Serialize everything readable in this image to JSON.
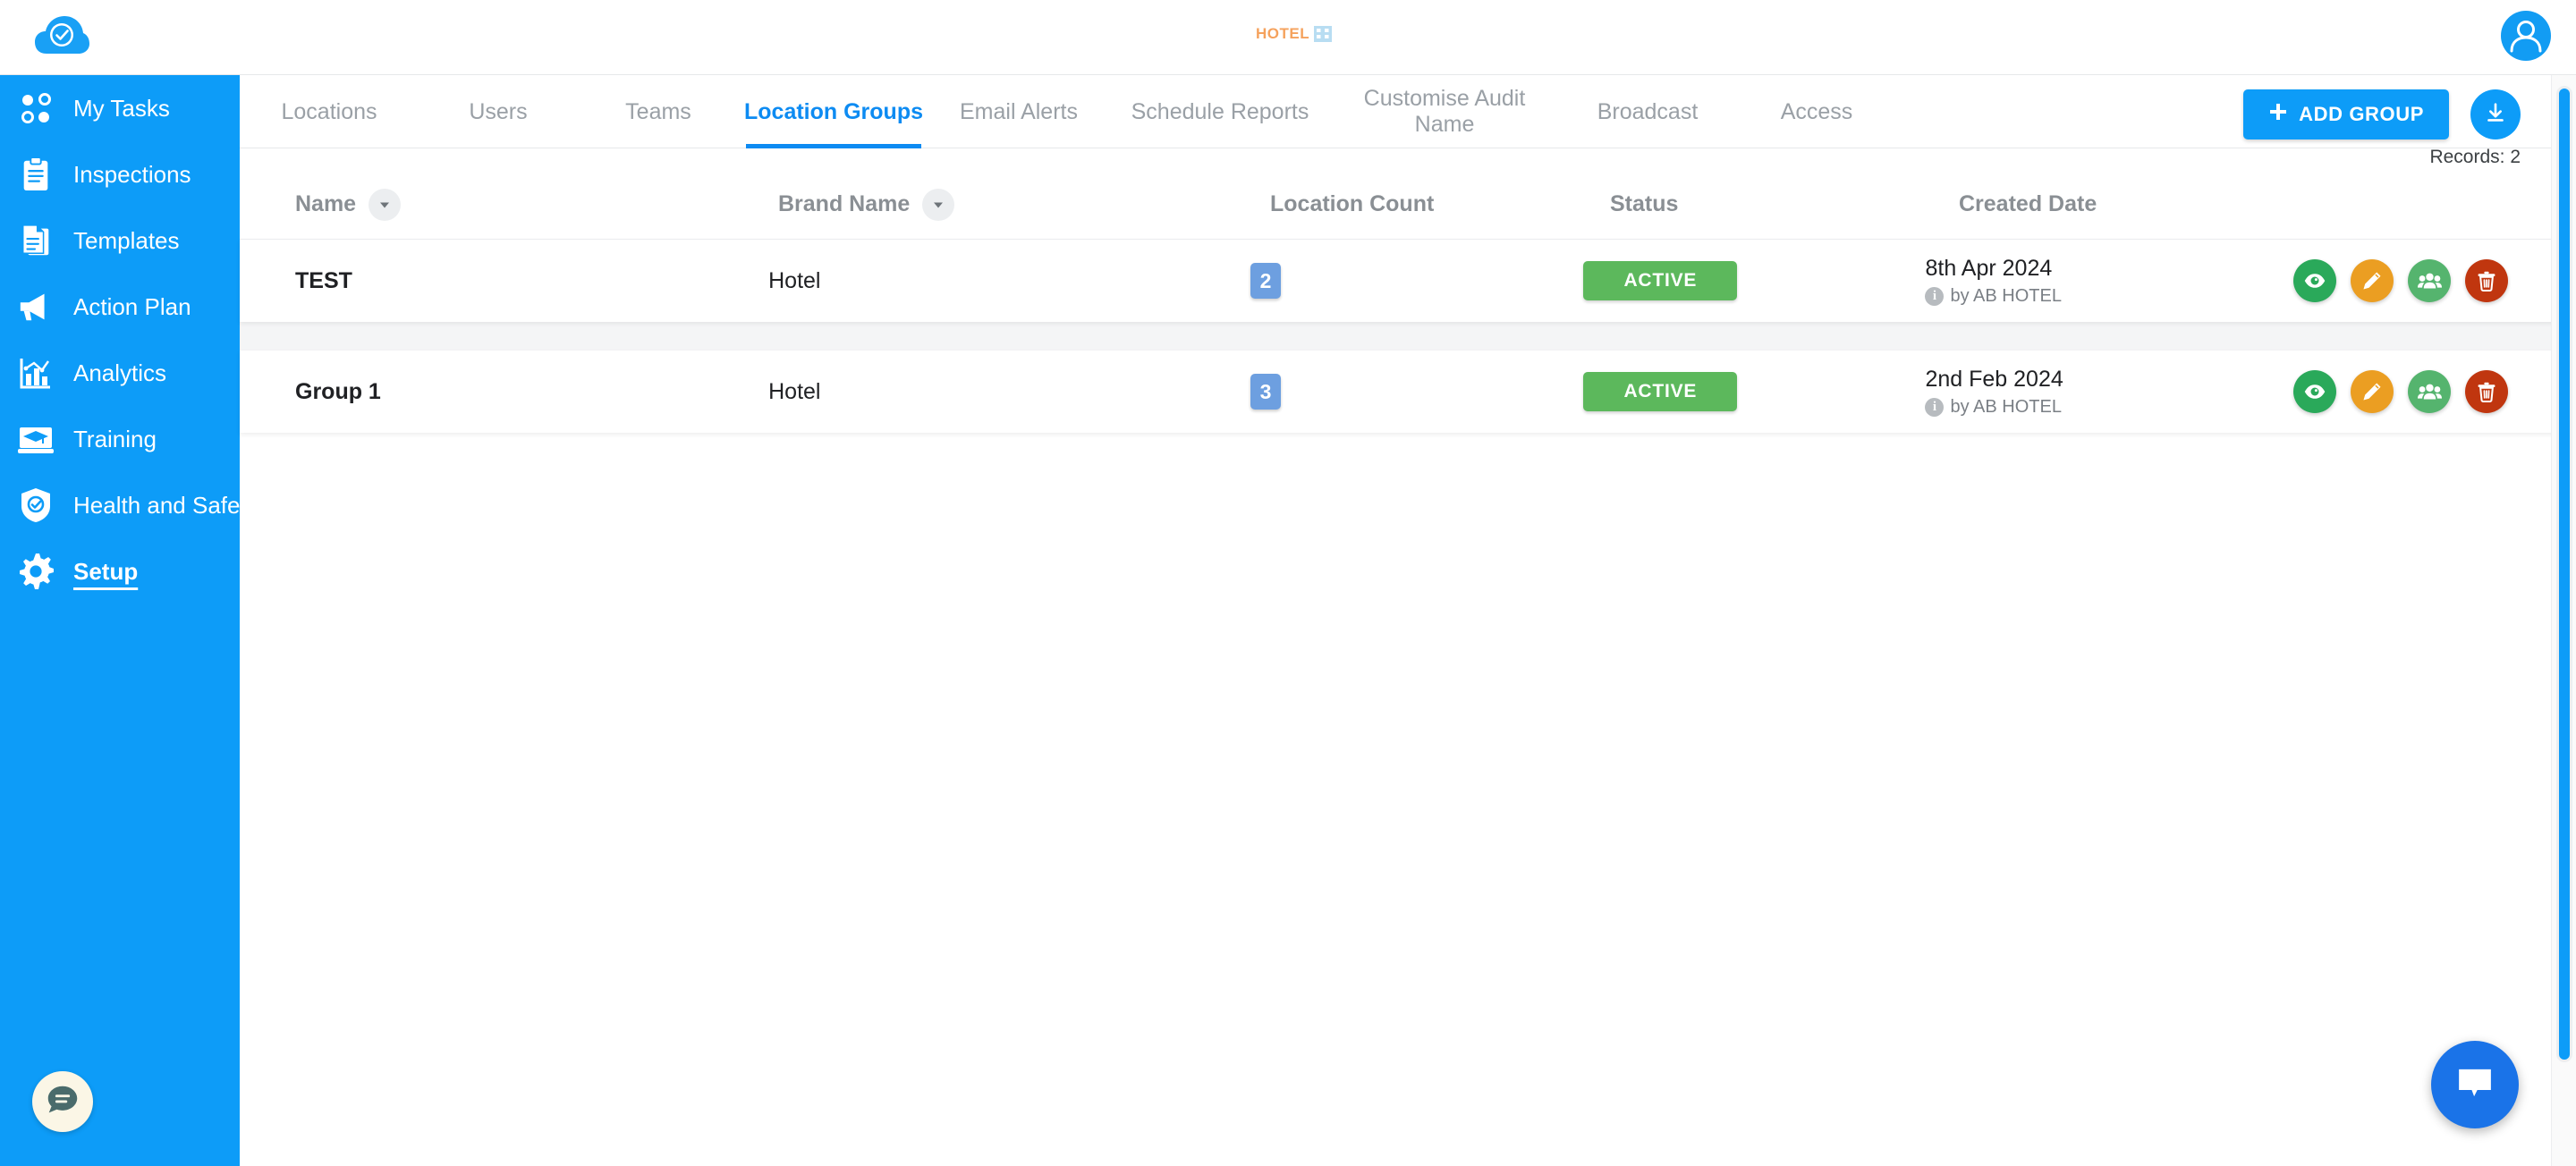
{
  "topbar": {
    "logo_icon": "cloud-check-icon",
    "brand_text": "HOTEL",
    "brand_icon": "building-icon",
    "avatar_icon": "user-avatar-icon"
  },
  "sidebar": {
    "items": [
      {
        "label": "My Tasks",
        "icon": "dots-grid-icon",
        "active": false
      },
      {
        "label": "Inspections",
        "icon": "clipboard-icon",
        "active": false
      },
      {
        "label": "Templates",
        "icon": "documents-icon",
        "active": false
      },
      {
        "label": "Action Plan",
        "icon": "megaphone-icon",
        "active": false
      },
      {
        "label": "Analytics",
        "icon": "bar-chart-icon",
        "active": false
      },
      {
        "label": "Training",
        "icon": "graduation-icon",
        "active": false
      },
      {
        "label": "Health and Safety",
        "icon": "shield-check-icon",
        "active": false
      },
      {
        "label": "Setup",
        "icon": "gear-icon",
        "active": true
      }
    ],
    "chat_icon": "chat-bubble-icon"
  },
  "tabs": [
    {
      "label": "Locations",
      "active": false
    },
    {
      "label": "Users",
      "active": false
    },
    {
      "label": "Teams",
      "active": false
    },
    {
      "label": "Location Groups",
      "active": true
    },
    {
      "label": "Email Alerts",
      "active": false
    },
    {
      "label": "Schedule Reports",
      "active": false
    },
    {
      "label": "Customise Audit Name",
      "active": false
    },
    {
      "label": "Broadcast",
      "active": false
    },
    {
      "label": "Access",
      "active": false
    }
  ],
  "toolbar": {
    "add_group_label": "ADD GROUP",
    "add_icon": "plus-icon",
    "download_icon": "download-icon",
    "records_label": "Records: 2"
  },
  "table": {
    "columns": [
      {
        "label": "Name",
        "sortable": true
      },
      {
        "label": "Brand Name",
        "sortable": true
      },
      {
        "label": "Location Count",
        "sortable": false
      },
      {
        "label": "Status",
        "sortable": false
      },
      {
        "label": "Created Date",
        "sortable": false
      }
    ],
    "rows": [
      {
        "name": "TEST",
        "brand": "Hotel",
        "count": "2",
        "status": "ACTIVE",
        "date": "8th Apr 2024",
        "author": "by AB HOTEL"
      },
      {
        "name": "Group 1",
        "brand": "Hotel",
        "count": "3",
        "status": "ACTIVE",
        "date": "2nd Feb 2024",
        "author": "by AB HOTEL"
      }
    ],
    "actions": [
      {
        "name": "view-button",
        "icon": "eye-icon"
      },
      {
        "name": "edit-button",
        "icon": "pencil-icon"
      },
      {
        "name": "assign-button",
        "icon": "users-icon"
      },
      {
        "name": "delete-button",
        "icon": "trash-icon"
      }
    ]
  },
  "chat_widget": {
    "icon": "chat-bubble-icon"
  },
  "colors": {
    "accent": "#0d9cf8",
    "active_tab": "#0d8bf2",
    "status_active": "#5cb85c",
    "count_badge": "#6d9fe0",
    "brand_text": "#f5a25d"
  }
}
